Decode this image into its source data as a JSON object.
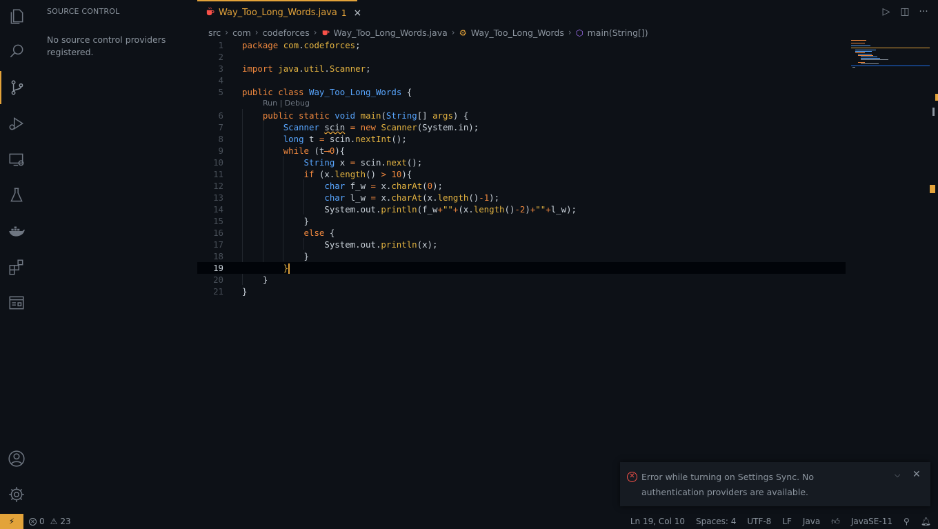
{
  "sidebar": {
    "title": "SOURCE CONTROL",
    "message": "No source control providers registered."
  },
  "tab": {
    "label": "Way_Too_Long_Words.java",
    "problems": "1",
    "close": "×"
  },
  "title_actions": {
    "run": "▷",
    "split": "◫",
    "more": "···"
  },
  "breadcrumb": {
    "items": [
      "src",
      "com",
      "codeforces",
      "Way_Too_Long_Words.java",
      "Way_Too_Long_Words",
      "main(String[])"
    ]
  },
  "editor": {
    "codelens": "Run | Debug",
    "current_line": 19,
    "line_numbers": [
      "1",
      "2",
      "3",
      "4",
      "5",
      "6",
      "7",
      "8",
      "9",
      "10",
      "11",
      "12",
      "13",
      "14",
      "15",
      "16",
      "17",
      "18",
      "19",
      "20",
      "21"
    ]
  },
  "notification": {
    "message": "Error while turning on Settings Sync. No authentication providers are available.",
    "chevron": "⌵",
    "close": "✕"
  },
  "statusbar": {
    "remote": "⚡",
    "errors": "0",
    "warnings": "23",
    "position": "Ln 19, Col 10",
    "spaces": "Spaces: 4",
    "encoding": "UTF-8",
    "eol": "LF",
    "language": "Java",
    "jdk": "JavaSE-11"
  },
  "colors": {
    "accent": "#e3a33a",
    "background": "#0d1117",
    "keyword": "#f0883e",
    "type": "#58a6ff",
    "function": "#e3b341",
    "error": "#f85149"
  }
}
